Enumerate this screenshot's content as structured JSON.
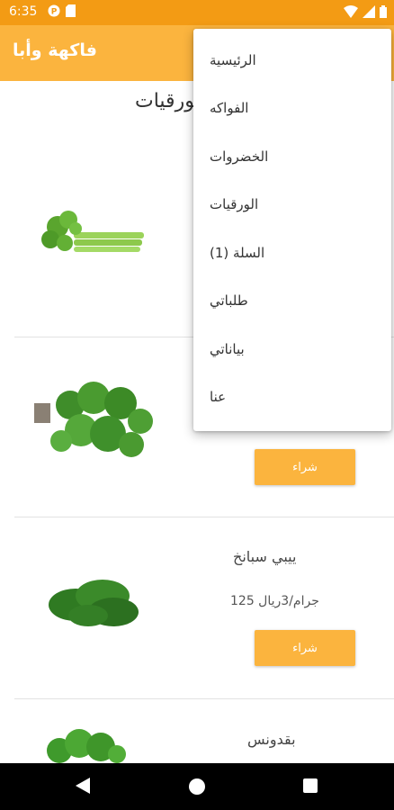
{
  "status": {
    "time": "6:35"
  },
  "appbar": {
    "title": "فاكهة وأبا"
  },
  "page": {
    "heading": "الورقيات"
  },
  "products": [
    {
      "name": "ييبي سبانخ",
      "price": "125 جرام/3ريال",
      "buy_label": "شراء"
    },
    {
      "name": "بقدونس"
    }
  ],
  "middle_product": {
    "buy_label": "شراء"
  },
  "menu": {
    "items": [
      {
        "label": "الرئيسية"
      },
      {
        "label": "الفواكه"
      },
      {
        "label": "الخضروات"
      },
      {
        "label": "الورقيات"
      },
      {
        "label": "السلة (1)"
      },
      {
        "label": "طلباتي"
      },
      {
        "label": "بياناتي"
      },
      {
        "label": "عنا"
      }
    ]
  },
  "colors": {
    "status_bar": "#f39b14",
    "app_bar": "#fbb43e",
    "button": "#fbb43e"
  }
}
